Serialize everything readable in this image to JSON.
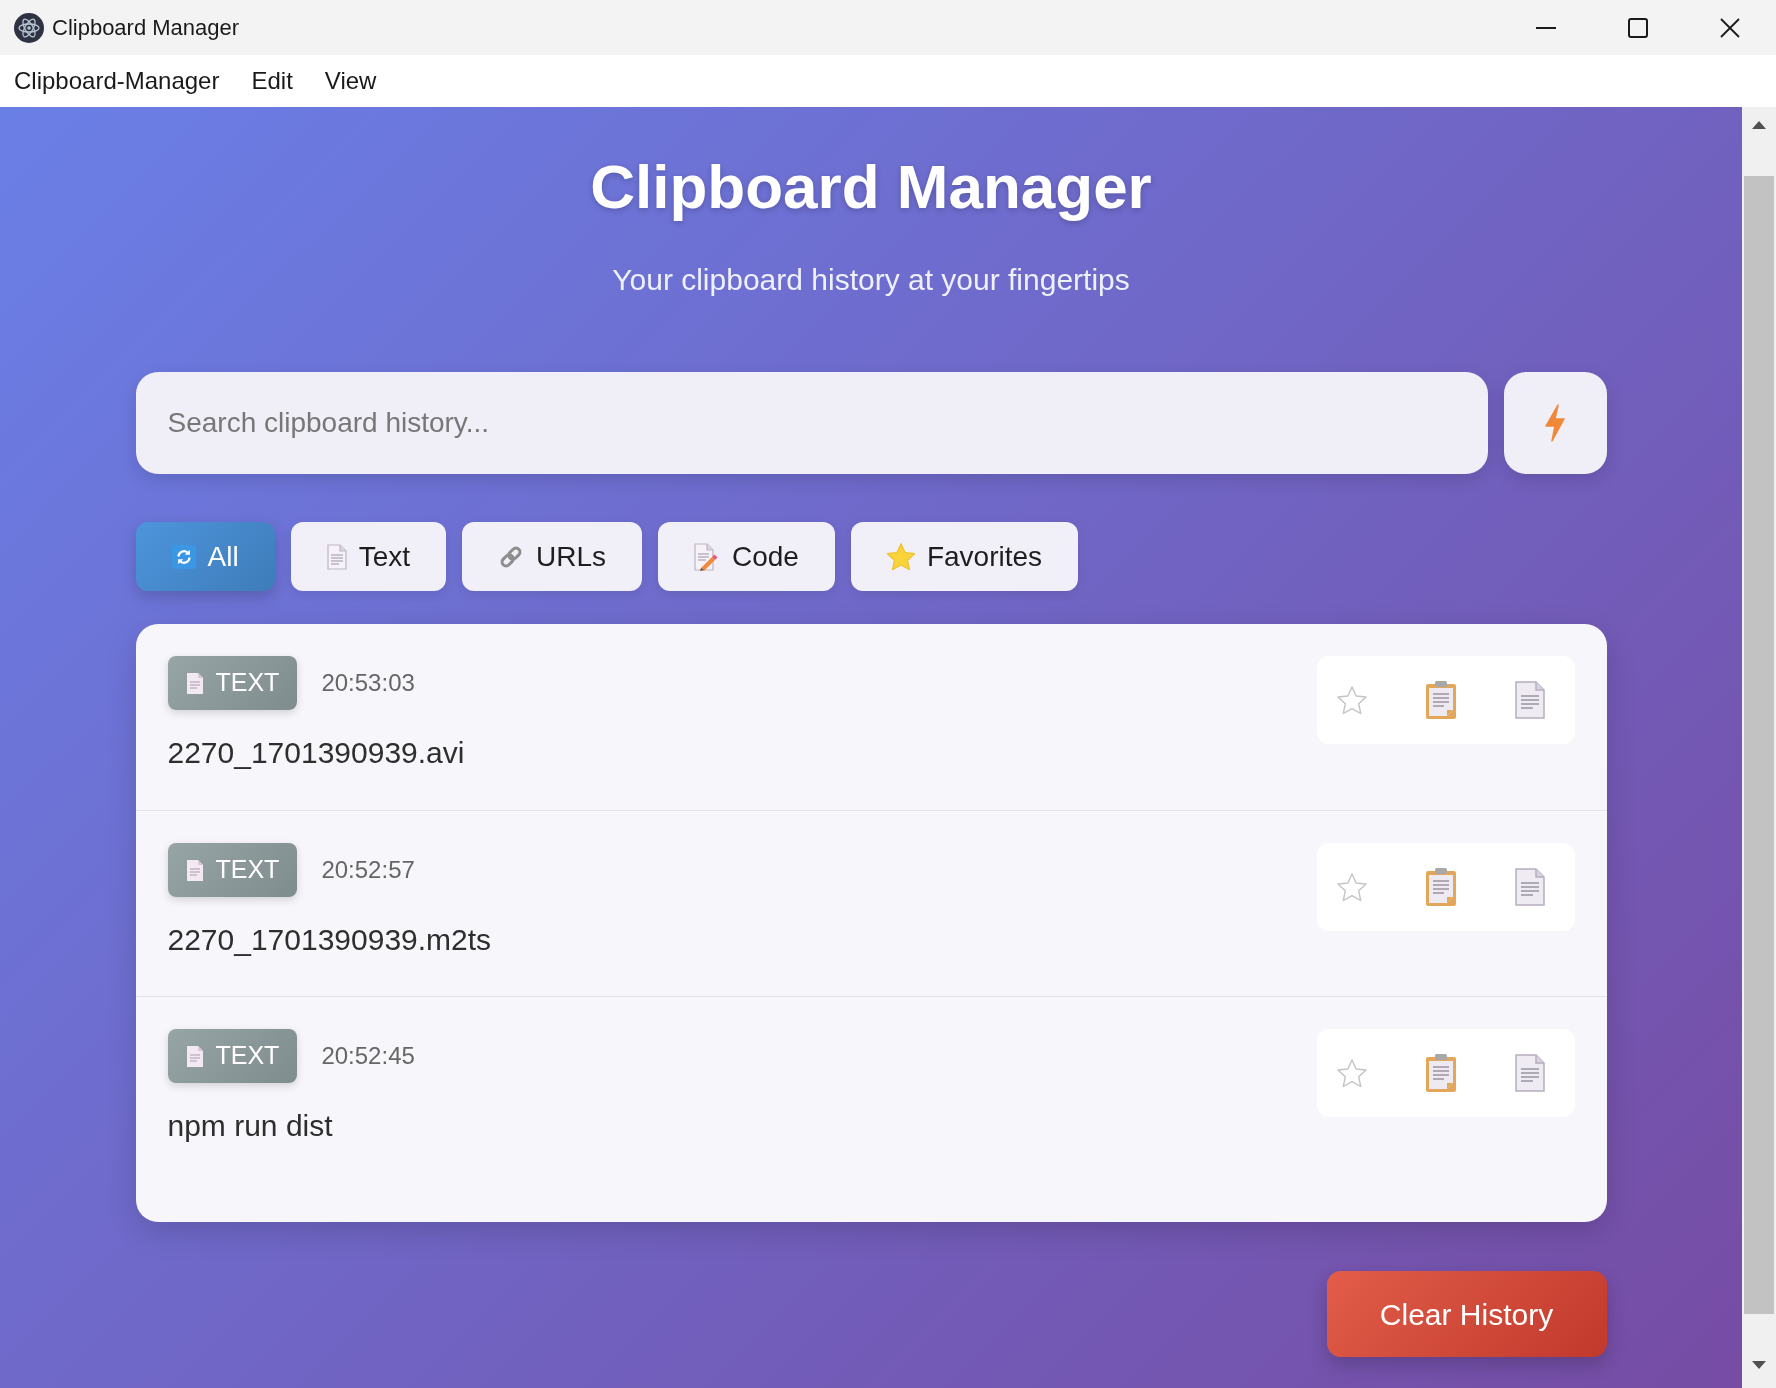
{
  "window": {
    "title": "Clipboard Manager"
  },
  "menu": [
    "Clipboard-Manager",
    "Edit",
    "View"
  ],
  "header": {
    "title": "Clipboard Manager",
    "subtitle": "Your clipboard history at your fingertips"
  },
  "search": {
    "placeholder": "Search clipboard history..."
  },
  "filters": [
    {
      "label": "All",
      "kind": "all",
      "selected": true
    },
    {
      "label": "Text",
      "kind": "text",
      "selected": false
    },
    {
      "label": "URLs",
      "kind": "url",
      "selected": false
    },
    {
      "label": "Code",
      "kind": "code",
      "selected": false
    },
    {
      "label": "Favorites",
      "kind": "favorites",
      "selected": false
    }
  ],
  "items": [
    {
      "kind": "text",
      "type_label": "TEXT",
      "time": "20:53:03",
      "content": "2270_1701390939.avi",
      "favorite": false
    },
    {
      "kind": "text",
      "type_label": "TEXT",
      "time": "20:52:57",
      "content": "2270_1701390939.m2ts",
      "favorite": false
    },
    {
      "kind": "text",
      "type_label": "TEXT",
      "time": "20:52:45",
      "content": "npm run dist",
      "favorite": false
    }
  ],
  "clear_button": {
    "label": "Clear History"
  }
}
